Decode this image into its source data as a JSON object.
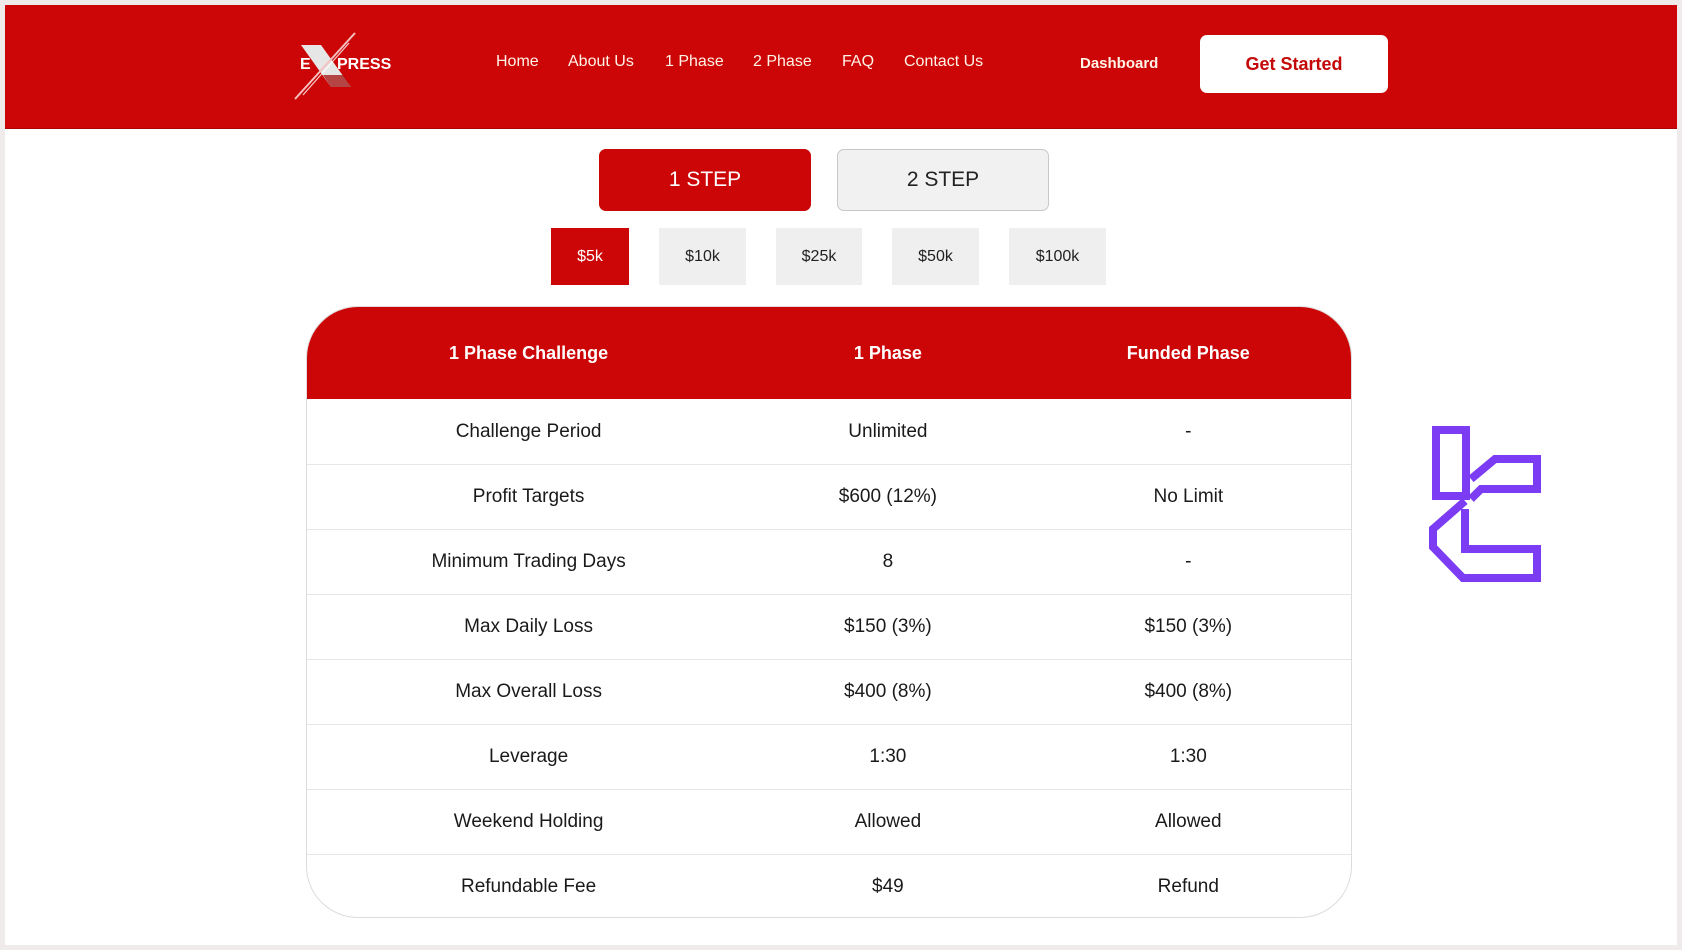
{
  "header": {
    "logo": {
      "text_left": "E",
      "text_right": "PRESS",
      "icon": "express-x-logo"
    },
    "nav": [
      "Home",
      "About Us",
      "1 Phase",
      "2 Phase",
      "FAQ",
      "Contact Us"
    ],
    "dashboard_label": "Dashboard",
    "get_started_label": "Get Started"
  },
  "steps": {
    "options": [
      "1 STEP",
      "2 STEP"
    ],
    "selected": "1 STEP"
  },
  "amounts": {
    "options": [
      "$5k",
      "$10k",
      "$25k",
      "$50k",
      "$100k"
    ],
    "selected": "$5k"
  },
  "table": {
    "headers": [
      "1 Phase Challenge",
      "1 Phase",
      "Funded Phase"
    ],
    "rows": [
      [
        "Challenge Period",
        "Unlimited",
        "-"
      ],
      [
        "Profit Targets",
        "$600 (12%)",
        "No Limit"
      ],
      [
        "Minimum Trading Days",
        "8",
        "-"
      ],
      [
        "Max Daily Loss",
        "$150 (3%)",
        "$150 (3%)"
      ],
      [
        "Max Overall Loss",
        "$400 (8%)",
        "$400 (8%)"
      ],
      [
        "Leverage",
        "1:30",
        "1:30"
      ],
      [
        "Weekend Holding",
        "Allowed",
        "Allowed"
      ],
      [
        "Refundable Fee",
        "$49",
        "Refund"
      ]
    ]
  },
  "watermark": {
    "icon": "tradingfinder-logo",
    "color": "#7b3cf4"
  },
  "colors": {
    "brand": "#cc0606",
    "inactive": "#efefef",
    "text": "#1a1a1a"
  }
}
